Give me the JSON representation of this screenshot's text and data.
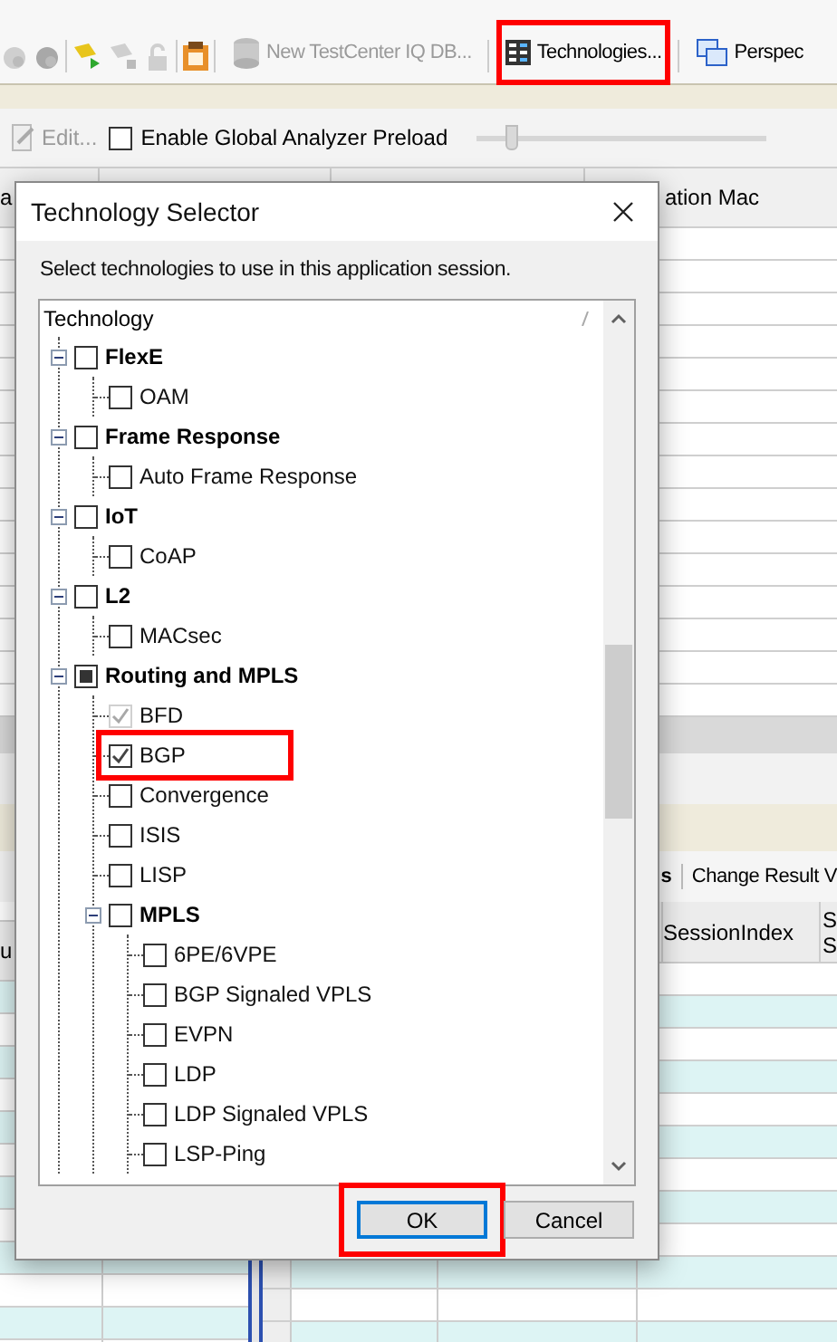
{
  "toolbar": {
    "items": [
      {
        "label": "New TestCenter IQ DB...",
        "disabled": true,
        "highlighted": false
      },
      {
        "label": "Technologies...",
        "disabled": false,
        "highlighted": true
      },
      {
        "label": "Perspec",
        "disabled": false,
        "highlighted": false
      }
    ]
  },
  "analyzer_toolbar": {
    "edit_button": {
      "label": "Edit...",
      "disabled": true
    },
    "preload_checkbox": {
      "label": "Enable Global Analyzer Preload",
      "checked": false
    },
    "slider": {
      "level": 0.1
    }
  },
  "upper_table": {
    "column_1": "a",
    "column_4": "ation Mac"
  },
  "lower_toolbar": {
    "items": [
      "s",
      "Change Result V"
    ]
  },
  "lower_table": {
    "left_column": "u",
    "column_1": "SessionIndex",
    "column_2": [
      "S",
      "S"
    ]
  },
  "dialog": {
    "title": "Technology Selector",
    "instruction": "Select technologies to use in this application session.",
    "tree": {
      "header": "Technology",
      "items": [
        {
          "kind": "group",
          "label": "FlexE",
          "checked": false,
          "partial": false,
          "disabled": false,
          "highlighted": false,
          "expanded": true,
          "children": [
            {
              "kind": "item",
              "label": "OAM",
              "checked": false,
              "partial": false,
              "disabled": false,
              "highlighted": false
            }
          ]
        },
        {
          "kind": "group",
          "label": "Frame Response",
          "checked": false,
          "partial": false,
          "disabled": false,
          "highlighted": false,
          "expanded": true,
          "children": [
            {
              "kind": "item",
              "label": "Auto Frame Response",
              "checked": false,
              "partial": false,
              "disabled": false,
              "highlighted": false
            }
          ]
        },
        {
          "kind": "group",
          "label": "IoT",
          "checked": false,
          "partial": false,
          "disabled": false,
          "highlighted": false,
          "expanded": true,
          "children": [
            {
              "kind": "item",
              "label": "CoAP",
              "checked": false,
              "partial": false,
              "disabled": false,
              "highlighted": false
            }
          ]
        },
        {
          "kind": "group",
          "label": "L2",
          "checked": false,
          "partial": false,
          "disabled": false,
          "highlighted": false,
          "expanded": true,
          "children": [
            {
              "kind": "item",
              "label": "MACsec",
              "checked": false,
              "partial": false,
              "disabled": false,
              "highlighted": false
            }
          ]
        },
        {
          "kind": "group",
          "label": "Routing and MPLS",
          "checked": false,
          "partial": true,
          "disabled": false,
          "highlighted": false,
          "expanded": true,
          "children": [
            {
              "kind": "item",
              "label": "BFD",
              "checked": true,
              "partial": false,
              "disabled": true,
              "highlighted": false
            },
            {
              "kind": "item",
              "label": "BGP",
              "checked": true,
              "partial": false,
              "disabled": false,
              "highlighted": true
            },
            {
              "kind": "item",
              "label": "Convergence",
              "checked": false,
              "partial": false,
              "disabled": false,
              "highlighted": false
            },
            {
              "kind": "item",
              "label": "ISIS",
              "checked": false,
              "partial": false,
              "disabled": false,
              "highlighted": false
            },
            {
              "kind": "item",
              "label": "LISP",
              "checked": false,
              "partial": false,
              "disabled": false,
              "highlighted": false
            },
            {
              "kind": "group",
              "label": "MPLS",
              "checked": false,
              "partial": false,
              "disabled": false,
              "highlighted": false,
              "expanded": true,
              "children": [
                {
                  "kind": "item",
                  "label": "6PE/6VPE",
                  "checked": false,
                  "partial": false,
                  "disabled": false,
                  "highlighted": false
                },
                {
                  "kind": "item",
                  "label": "BGP Signaled VPLS",
                  "checked": false,
                  "partial": false,
                  "disabled": false,
                  "highlighted": false
                },
                {
                  "kind": "item",
                  "label": "EVPN",
                  "checked": false,
                  "partial": false,
                  "disabled": false,
                  "highlighted": false
                },
                {
                  "kind": "item",
                  "label": "LDP",
                  "checked": false,
                  "partial": false,
                  "disabled": false,
                  "highlighted": false
                },
                {
                  "kind": "item",
                  "label": "LDP Signaled VPLS",
                  "checked": false,
                  "partial": false,
                  "disabled": false,
                  "highlighted": false
                },
                {
                  "kind": "item",
                  "label": "LSP-Ping",
                  "checked": false,
                  "partial": false,
                  "disabled": false,
                  "highlighted": false
                }
              ]
            }
          ]
        }
      ]
    },
    "buttons": [
      {
        "label": "OK",
        "default": true,
        "highlighted": true
      },
      {
        "label": "Cancel",
        "default": false,
        "highlighted": false
      }
    ]
  }
}
